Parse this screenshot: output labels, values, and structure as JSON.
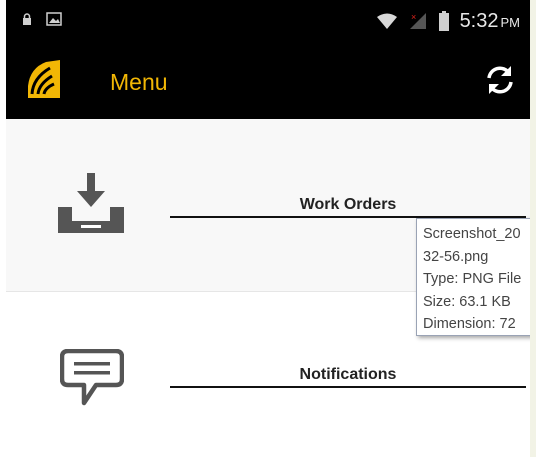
{
  "status_bar": {
    "time": "5:32",
    "ampm": "PM",
    "icons": [
      "lock-icon",
      "gallery-icon",
      "wifi-icon",
      "signal-icon",
      "battery-icon"
    ]
  },
  "header": {
    "title": "Menu",
    "logo_icon": "wifi-wave-logo",
    "refresh_icon": "refresh-icon"
  },
  "menu": {
    "items": [
      {
        "label": "Work Orders",
        "icon": "download-tray-icon"
      },
      {
        "label": "Notifications",
        "icon": "speech-bubble-icon"
      }
    ]
  },
  "tooltip": {
    "lines": [
      "Screenshot_20",
      "32-56.png",
      "Type: PNG File",
      "Size: 63.1 KB",
      "Dimension: 72"
    ]
  },
  "colors": {
    "accent": "#f2b705",
    "header_bg": "#000000",
    "icon_gray": "#555555"
  }
}
